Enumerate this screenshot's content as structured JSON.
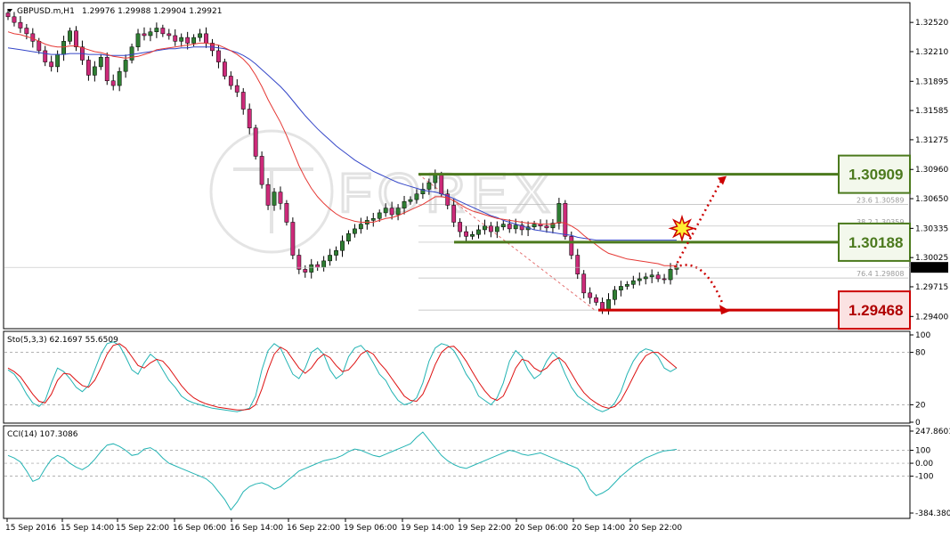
{
  "header": {
    "symbol": "GBPUSD.m,H1",
    "ohlc": "1.29976 1.29988 1.29904 1.29921",
    "menu_icon": "triangle-down-icon"
  },
  "watermark": "FOREX",
  "colors": {
    "bull": "#2e7d32",
    "bear": "#cc2a79",
    "ma_fast": "#e53935",
    "ma_slow": "#3446c8",
    "green_level": "#4c7a1e",
    "red_level": "#cc0000",
    "stoch_main": "#22b3b3",
    "stoch_signal": "#dd1111",
    "cci": "#22b3b3"
  },
  "chart_data": [
    {
      "type": "candlestick",
      "title": "GBPUSD.m,H1",
      "y_ticks": [
        "1.32520",
        "1.32210",
        "1.31895",
        "1.31585",
        "1.31275",
        "1.30960",
        "1.30650",
        "1.30335",
        "1.30025",
        "1.29715",
        "1.29400"
      ],
      "ylim": [
        1.2928,
        1.3272
      ],
      "x_ticks": [
        "15 Sep 2016",
        "15 Sep 14:00",
        "15 Sep 22:00",
        "16 Sep 06:00",
        "16 Sep 14:00",
        "16 Sep 22:00",
        "19 Sep 06:00",
        "19 Sep 14:00",
        "19 Sep 22:00",
        "20 Sep 06:00",
        "20 Sep 14:00",
        "20 Sep 22:00"
      ],
      "current_price": "1.29921",
      "closes": [
        1.3258,
        1.3252,
        1.3246,
        1.324,
        1.3232,
        1.3222,
        1.321,
        1.3205,
        1.3218,
        1.3232,
        1.3243,
        1.3226,
        1.3212,
        1.3196,
        1.3205,
        1.3215,
        1.319,
        1.3185,
        1.32,
        1.3212,
        1.3226,
        1.324,
        1.3238,
        1.3242,
        1.3246,
        1.324,
        1.3238,
        1.3232,
        1.3236,
        1.323,
        1.3236,
        1.324,
        1.323,
        1.3222,
        1.321,
        1.3195,
        1.3185,
        1.3178,
        1.316,
        1.314,
        1.311,
        1.308,
        1.3058,
        1.3072,
        1.306,
        1.304,
        1.3005,
        1.299,
        1.2987,
        1.2995,
        1.2992,
        1.2999,
        1.3005,
        1.301,
        1.302,
        1.3028,
        1.3033,
        1.3038,
        1.3042,
        1.3044,
        1.305,
        1.3055,
        1.3048,
        1.3055,
        1.3062,
        1.3064,
        1.307,
        1.3075,
        1.3082,
        1.309,
        1.307,
        1.3058,
        1.304,
        1.303,
        1.3025,
        1.3027,
        1.3032,
        1.3036,
        1.303,
        1.3035,
        1.3038,
        1.3033,
        1.3037,
        1.3032,
        1.3035,
        1.3038,
        1.3036,
        1.3034,
        1.3039,
        1.306,
        1.3025,
        1.3005,
        1.2985,
        1.2965,
        1.296,
        1.2955,
        1.2947,
        1.2958,
        1.2968,
        1.2972,
        1.2974,
        1.2978,
        1.298,
        1.2982,
        1.2984,
        1.298,
        1.2979,
        1.299,
        1.2992
      ],
      "open_first": 1.3262,
      "ma_fast": [
        1.3242,
        1.324,
        1.3239,
        1.3237,
        1.3235,
        1.3232,
        1.3229,
        1.3227,
        1.3226,
        1.3226,
        1.3227,
        1.3227,
        1.3225,
        1.3223,
        1.3221,
        1.322,
        1.3218,
        1.3216,
        1.3215,
        1.3214,
        1.3215,
        1.3216,
        1.3218,
        1.322,
        1.3223,
        1.3224,
        1.3225,
        1.3226,
        1.3227,
        1.3228,
        1.3229,
        1.323,
        1.323,
        1.3229,
        1.3228,
        1.3225,
        1.3222,
        1.3218,
        1.3213,
        1.3206,
        1.3196,
        1.3184,
        1.317,
        1.3158,
        1.3146,
        1.3132,
        1.3116,
        1.31,
        1.3087,
        1.3076,
        1.3067,
        1.306,
        1.3054,
        1.3049,
        1.3045,
        1.3043,
        1.3041,
        1.304,
        1.304,
        1.304,
        1.3042,
        1.3044,
        1.3045,
        1.3047,
        1.305,
        1.3053,
        1.3056,
        1.3059,
        1.3063,
        1.3067,
        1.3067,
        1.3066,
        1.3063,
        1.3059,
        1.3055,
        1.3052,
        1.305,
        1.3048,
        1.3046,
        1.3044,
        1.3043,
        1.3042,
        1.3041,
        1.304,
        1.3039,
        1.3039,
        1.3038,
        1.3038,
        1.3038,
        1.304,
        1.3039,
        1.3036,
        1.3032,
        1.3026,
        1.3021,
        1.3016,
        1.3011,
        1.3007,
        1.3005,
        1.3003,
        1.3001,
        1.3,
        1.2999,
        1.2998,
        1.2997,
        1.2996,
        1.2994,
        1.2994,
        1.2994
      ],
      "ma_slow": [
        1.3225,
        1.3224,
        1.3223,
        1.3222,
        1.3221,
        1.322,
        1.3219,
        1.3218,
        1.3218,
        1.3218,
        1.3219,
        1.3219,
        1.3219,
        1.3218,
        1.3218,
        1.3218,
        1.3217,
        1.3217,
        1.3217,
        1.3217,
        1.3218,
        1.3219,
        1.322,
        1.3221,
        1.3222,
        1.3223,
        1.3224,
        1.3224,
        1.3225,
        1.3225,
        1.3226,
        1.3226,
        1.3226,
        1.3226,
        1.3225,
        1.3224,
        1.3222,
        1.322,
        1.3217,
        1.3213,
        1.3208,
        1.3202,
        1.3196,
        1.319,
        1.3184,
        1.3177,
        1.3169,
        1.3161,
        1.3153,
        1.3146,
        1.3139,
        1.3133,
        1.3127,
        1.3121,
        1.3116,
        1.3111,
        1.3106,
        1.3102,
        1.3098,
        1.3094,
        1.3091,
        1.3088,
        1.3085,
        1.3082,
        1.308,
        1.3078,
        1.3076,
        1.3074,
        1.3073,
        1.3072,
        1.307,
        1.3068,
        1.3065,
        1.3062,
        1.3059,
        1.3056,
        1.3053,
        1.305,
        1.3047,
        1.3045,
        1.3042,
        1.304,
        1.3038,
        1.3036,
        1.3034,
        1.3032,
        1.3031,
        1.303,
        1.3029,
        1.3028,
        1.3027,
        1.3026,
        1.3024,
        1.3023,
        1.3022,
        1.3021,
        1.3021,
        1.3021,
        1.3021,
        1.3021,
        1.3021,
        1.3021,
        1.3021,
        1.3021,
        1.3021,
        1.3021,
        1.3021,
        1.3021,
        1.3021
      ],
      "fib_levels": [
        {
          "label": "23.6 1.30589",
          "value": 1.30589
        },
        {
          "label": "38.2 1.30359",
          "value": 1.30359
        },
        {
          "label": "76.4 1.29808",
          "value": 1.29808
        }
      ],
      "levels": [
        {
          "name": "resistance",
          "value": 1.30909,
          "label": "1.30909",
          "color": "#4c7a1e"
        },
        {
          "name": "pivot",
          "value": 1.30188,
          "label": "1.30188",
          "color": "#4c7a1e"
        },
        {
          "name": "support",
          "value": 1.29468,
          "label": "1.29468",
          "color": "#cc0000"
        }
      ]
    },
    {
      "type": "line",
      "title": "Sto(5,3,3) 62.1697 55.6509",
      "y_ticks": [
        "100",
        "80",
        "20",
        "0"
      ],
      "ylim": [
        0,
        100
      ],
      "series": [
        {
          "name": "main",
          "values": [
            60,
            55,
            45,
            32,
            22,
            18,
            25,
            45,
            62,
            58,
            50,
            40,
            35,
            42,
            60,
            78,
            90,
            92,
            88,
            75,
            60,
            55,
            68,
            78,
            72,
            60,
            48,
            40,
            30,
            25,
            22,
            20,
            18,
            16,
            15,
            14,
            13,
            12,
            14,
            16,
            30,
            60,
            82,
            90,
            85,
            70,
            55,
            50,
            62,
            80,
            85,
            78,
            60,
            50,
            55,
            75,
            85,
            88,
            80,
            68,
            55,
            48,
            35,
            25,
            20,
            22,
            28,
            45,
            70,
            85,
            90,
            88,
            82,
            70,
            55,
            45,
            30,
            25,
            20,
            28,
            45,
            70,
            82,
            75,
            60,
            50,
            55,
            70,
            80,
            72,
            55,
            40,
            30,
            25,
            20,
            15,
            12,
            15,
            22,
            35,
            55,
            70,
            80,
            84,
            82,
            75,
            62,
            58,
            62
          ]
        },
        {
          "name": "signal",
          "values": [
            62,
            58,
            52,
            42,
            32,
            24,
            22,
            32,
            48,
            56,
            55,
            48,
            42,
            40,
            48,
            62,
            78,
            88,
            90,
            85,
            75,
            65,
            62,
            68,
            72,
            70,
            62,
            52,
            42,
            34,
            28,
            24,
            21,
            19,
            17,
            16,
            15,
            14,
            14,
            15,
            20,
            38,
            60,
            78,
            86,
            82,
            72,
            62,
            56,
            62,
            72,
            78,
            74,
            65,
            58,
            60,
            68,
            78,
            82,
            78,
            68,
            60,
            50,
            40,
            30,
            25,
            24,
            32,
            48,
            66,
            80,
            86,
            87,
            80,
            70,
            58,
            46,
            36,
            28,
            25,
            30,
            45,
            62,
            72,
            70,
            62,
            58,
            62,
            70,
            74,
            68,
            56,
            44,
            34,
            27,
            22,
            18,
            16,
            18,
            25,
            38,
            52,
            66,
            76,
            80,
            80,
            74,
            68,
            62
          ]
        }
      ]
    },
    {
      "type": "line",
      "title": "CCI(14) 107.3086",
      "y_ticks": [
        "247.8601",
        "100",
        "0.00",
        "-100",
        "-384.3807"
      ],
      "ylim": [
        -384.3807,
        247.8601
      ],
      "series": [
        {
          "name": "cci",
          "values": [
            60,
            40,
            10,
            -60,
            -140,
            -120,
            -40,
            30,
            60,
            40,
            0,
            -30,
            -50,
            -20,
            30,
            90,
            140,
            150,
            130,
            100,
            60,
            70,
            110,
            120,
            90,
            40,
            0,
            -20,
            -40,
            -60,
            -80,
            -100,
            -120,
            -160,
            -220,
            -280,
            -360,
            -300,
            -220,
            -180,
            -160,
            -150,
            -170,
            -200,
            -180,
            -140,
            -100,
            -60,
            -40,
            -20,
            0,
            20,
            30,
            40,
            60,
            90,
            110,
            100,
            80,
            60,
            50,
            70,
            90,
            110,
            130,
            150,
            200,
            240,
            180,
            120,
            60,
            20,
            -10,
            -30,
            -40,
            -20,
            0,
            20,
            40,
            60,
            80,
            100,
            90,
            70,
            60,
            70,
            80,
            60,
            40,
            20,
            0,
            -20,
            -40,
            -100,
            -200,
            -250,
            -230,
            -200,
            -150,
            -100,
            -60,
            -20,
            10,
            40,
            60,
            80,
            95,
            100,
            107.3
          ]
        }
      ]
    }
  ]
}
